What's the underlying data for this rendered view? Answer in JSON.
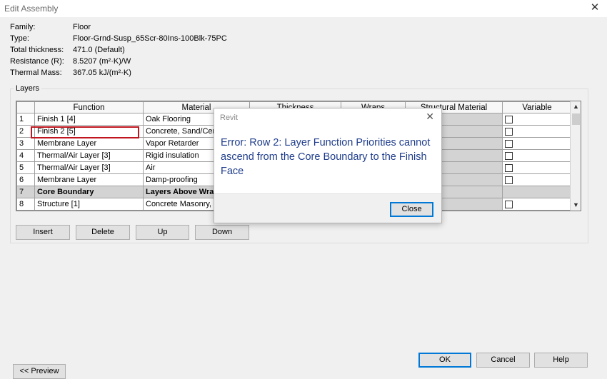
{
  "window": {
    "title": "Edit Assembly"
  },
  "properties": [
    {
      "label": "Family:",
      "value": "Floor"
    },
    {
      "label": "Type:",
      "value": "Floor-Grnd-Susp_65Scr-80Ins-100Blk-75PC"
    },
    {
      "label": "Total thickness:",
      "value": "471.0 (Default)"
    },
    {
      "label": "Resistance (R):",
      "value": "8.5207 (m²·K)/W"
    },
    {
      "label": "Thermal Mass:",
      "value": "367.05 kJ/(m²·K)"
    }
  ],
  "layers": {
    "group_label": "Layers",
    "columns": [
      "Function",
      "Material",
      "Thickness",
      "Wraps",
      "Structural Material",
      "Variable"
    ],
    "rows": [
      {
        "num": "1",
        "function": "Finish 1 [4]",
        "material": "Oak Flooring"
      },
      {
        "num": "2",
        "function": "Finish 2 [5]",
        "material": "Concrete, Sand/Cem"
      },
      {
        "num": "3",
        "function": "Membrane Layer",
        "material": "Vapor Retarder"
      },
      {
        "num": "4",
        "function": "Thermal/Air Layer [3]",
        "material": "Rigid insulation"
      },
      {
        "num": "5",
        "function": "Thermal/Air Layer [3]",
        "material": "Air"
      },
      {
        "num": "6",
        "function": "Membrane Layer",
        "material": "Damp-proofing"
      },
      {
        "num": "7",
        "function": "Core Boundary",
        "material": "Layers Above Wrap"
      },
      {
        "num": "8",
        "function": "Structure [1]",
        "material": "Concrete Masonry, Fl"
      }
    ]
  },
  "buttons": {
    "insert": "Insert",
    "delete": "Delete",
    "up": "Up",
    "down": "Down",
    "ok": "OK",
    "cancel": "Cancel",
    "help": "Help",
    "preview": "<< Preview"
  },
  "dialog": {
    "title": "Revit",
    "message": "Error: Row   2: Layer Function Priorities cannot ascend from the Core Boundary to the Finish Face",
    "close_label": "Close"
  }
}
